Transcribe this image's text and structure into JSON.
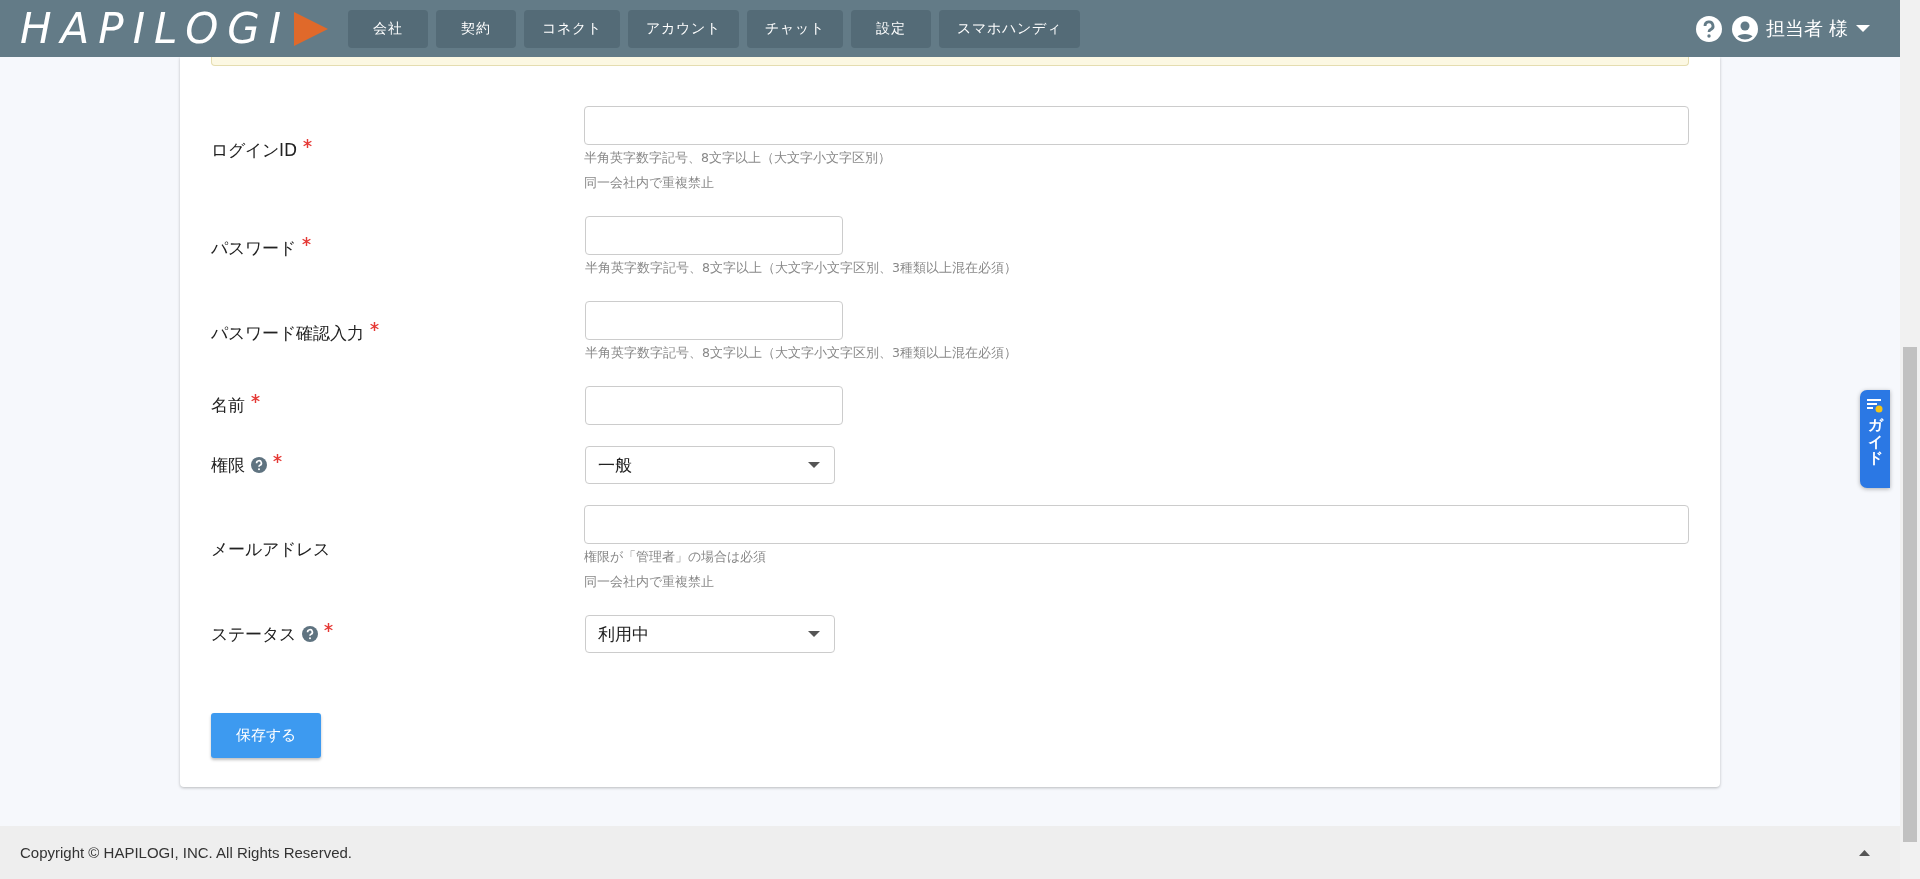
{
  "header": {
    "logo": "HAPILOGI",
    "nav": [
      "会社",
      "契約",
      "コネクト",
      "アカウント",
      "チャット",
      "設定",
      "スマホハンディ"
    ],
    "user": "担当者 様"
  },
  "form": {
    "fields": [
      {
        "label": "ログインID",
        "required": true,
        "help": false,
        "kind": "long-text",
        "hints": [
          "半角英字数字記号、8文字以上（大文字小文字区別）",
          "同一会社内で重複禁止"
        ]
      },
      {
        "label": "パスワード",
        "required": true,
        "help": false,
        "kind": "short-text",
        "hints": [
          "半角英字数字記号、8文字以上（大文字小文字区別、3種類以上混在必須）"
        ]
      },
      {
        "label": "パスワード確認入力",
        "required": true,
        "help": false,
        "kind": "short-text",
        "hints": [
          "半角英字数字記号、8文字以上（大文字小文字区別、3種類以上混在必須）"
        ]
      },
      {
        "label": "名前",
        "required": true,
        "help": false,
        "kind": "short-text"
      },
      {
        "label": "権限",
        "required": true,
        "help": true,
        "kind": "select",
        "value": "一般"
      },
      {
        "label": "メールアドレス",
        "required": false,
        "help": false,
        "kind": "long-text",
        "hints": [
          "権限が「管理者」の場合は必須",
          "同一会社内で重複禁止"
        ]
      },
      {
        "label": "ステータス",
        "required": true,
        "help": true,
        "kind": "select",
        "value": "利用中"
      }
    ],
    "submit": "保存する"
  },
  "guide_tab": {
    "label": "ガイド"
  },
  "footer": {
    "copyright": "Copyright © HAPILOGI, INC. All Rights Reserved."
  }
}
